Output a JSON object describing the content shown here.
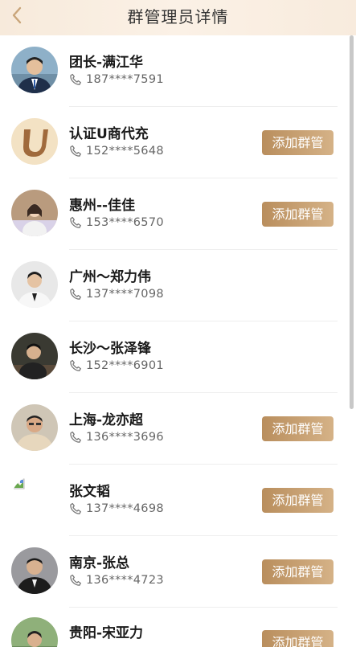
{
  "header": {
    "title": "群管理员详情"
  },
  "admins": [
    {
      "name": "团长-满江华",
      "phone": "187****7591",
      "button": ""
    },
    {
      "name": "认证U商代充",
      "phone": "152****5648",
      "button": "添加群管"
    },
    {
      "name": "惠州--佳佳",
      "phone": "153****6570",
      "button": "添加群管"
    },
    {
      "name": "广州～郑力伟",
      "phone": "137****7098",
      "button": ""
    },
    {
      "name": "长沙～张泽锋",
      "phone": "152****6901",
      "button": ""
    },
    {
      "name": "上海-龙亦超",
      "phone": "136****3696",
      "button": "添加群管"
    },
    {
      "name": "张文韬",
      "phone": "137****4698",
      "button": "添加群管"
    },
    {
      "name": "南京-张总",
      "phone": "136****4723",
      "button": "添加群管"
    },
    {
      "name": "贵阳-宋亚力",
      "phone": "",
      "button": "添加群管"
    }
  ],
  "colors": {
    "accent": "#c49f72",
    "header_bg": "#f8ecdf"
  },
  "icons": {
    "back": "chevron-left-icon",
    "phone": "phone-icon"
  }
}
